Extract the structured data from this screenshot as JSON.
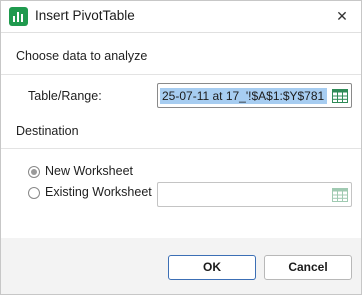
{
  "window": {
    "title": "Insert PivotTable",
    "close_glyph": "✕",
    "app_icon": "pivot-chart-icon"
  },
  "choose_data": {
    "heading": "Choose data to analyze",
    "range_label": "Table/Range:",
    "range_value": "25-07-11 at 17_'!$A$1:$Y$781"
  },
  "destination": {
    "heading": "Destination",
    "new_worksheet_label": "New Worksheet",
    "existing_worksheet_label": "Existing Worksheet",
    "selected": "New Worksheet",
    "existing_value": ""
  },
  "buttons": {
    "ok": "OK",
    "cancel": "Cancel"
  },
  "colors": {
    "accent_green": "#1f9a4e",
    "selection_blue": "#a7cdf1",
    "ok_border": "#3c6fb5"
  }
}
